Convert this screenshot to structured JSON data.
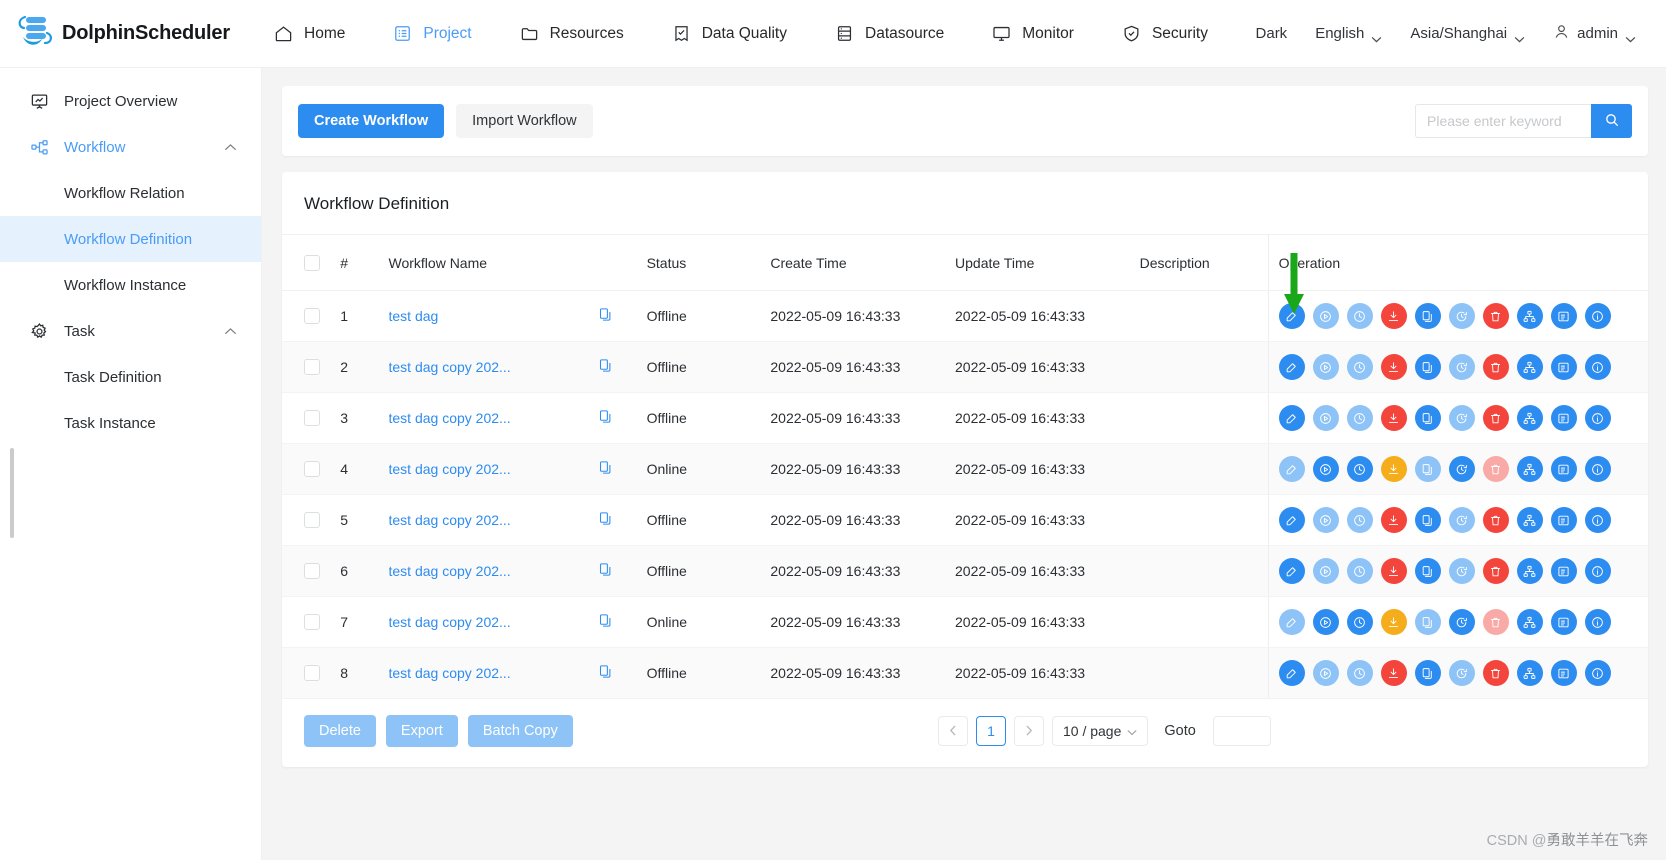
{
  "app": {
    "brand": "DolphinScheduler",
    "nav": [
      {
        "label": "Home",
        "icon": "home-icon",
        "active": false
      },
      {
        "label": "Project",
        "icon": "project-icon",
        "active": true
      },
      {
        "label": "Resources",
        "icon": "folder-icon",
        "active": false
      },
      {
        "label": "Data Quality",
        "icon": "data-quality-icon",
        "active": false
      },
      {
        "label": "Datasource",
        "icon": "database-icon",
        "active": false
      },
      {
        "label": "Monitor",
        "icon": "monitor-icon",
        "active": false
      },
      {
        "label": "Security",
        "icon": "shield-icon",
        "active": false
      }
    ],
    "nav_right": {
      "theme": "Dark",
      "language": "English",
      "timezone": "Asia/Shanghai",
      "user": "admin"
    },
    "accent_color": "#2d8cf0"
  },
  "sidebar": {
    "items": [
      {
        "label": "Project Overview",
        "icon": "overview-icon",
        "type": "item",
        "state": "normal"
      },
      {
        "label": "Workflow",
        "icon": "workflow-icon",
        "type": "group",
        "state": "accent",
        "expanded": true
      },
      {
        "label": "Workflow Relation",
        "type": "sub",
        "state": "normal"
      },
      {
        "label": "Workflow Definition",
        "type": "sub",
        "state": "selected"
      },
      {
        "label": "Workflow Instance",
        "type": "sub",
        "state": "normal"
      },
      {
        "label": "Task",
        "icon": "gear-icon",
        "type": "group",
        "state": "normal",
        "expanded": true
      },
      {
        "label": "Task Definition",
        "type": "sub",
        "state": "normal"
      },
      {
        "label": "Task Instance",
        "type": "sub",
        "state": "normal"
      }
    ]
  },
  "toolbar": {
    "create_label": "Create Workflow",
    "import_label": "Import Workflow",
    "search_placeholder": "Please enter keyword",
    "search_value": "",
    "search_icon": "search-icon"
  },
  "card": {
    "title": "Workflow Definition"
  },
  "table": {
    "columns": [
      "#",
      "Workflow Name",
      "Status",
      "Create Time",
      "Update Time",
      "Description",
      "Operation"
    ],
    "rows": [
      {
        "idx": "1",
        "name": "test dag",
        "status": "Offline",
        "create": "2022-05-09 16:43:33",
        "update": "2022-05-09 16:43:33",
        "desc": "",
        "checked": false
      },
      {
        "idx": "2",
        "name": "test dag copy 202...",
        "status": "Offline",
        "create": "2022-05-09 16:43:33",
        "update": "2022-05-09 16:43:33",
        "desc": "",
        "checked": false
      },
      {
        "idx": "3",
        "name": "test dag copy 202...",
        "status": "Offline",
        "create": "2022-05-09 16:43:33",
        "update": "2022-05-09 16:43:33",
        "desc": "",
        "checked": false
      },
      {
        "idx": "4",
        "name": "test dag copy 202...",
        "status": "Online",
        "create": "2022-05-09 16:43:33",
        "update": "2022-05-09 16:43:33",
        "desc": "",
        "checked": false
      },
      {
        "idx": "5",
        "name": "test dag copy 202...",
        "status": "Offline",
        "create": "2022-05-09 16:43:33",
        "update": "2022-05-09 16:43:33",
        "desc": "",
        "checked": false
      },
      {
        "idx": "6",
        "name": "test dag copy 202...",
        "status": "Offline",
        "create": "2022-05-09 16:43:33",
        "update": "2022-05-09 16:43:33",
        "desc": "",
        "checked": false
      },
      {
        "idx": "7",
        "name": "test dag copy 202...",
        "status": "Online",
        "create": "2022-05-09 16:43:33",
        "update": "2022-05-09 16:43:33",
        "desc": "",
        "checked": false
      },
      {
        "idx": "8",
        "name": "test dag copy 202...",
        "status": "Offline",
        "create": "2022-05-09 16:43:33",
        "update": "2022-05-09 16:43:33",
        "desc": "",
        "checked": false
      }
    ],
    "operations": [
      {
        "name": "edit-icon",
        "title": "Edit"
      },
      {
        "name": "start-icon",
        "title": "Start"
      },
      {
        "name": "timing-icon",
        "title": "Timing"
      },
      {
        "name": "download-icon",
        "title": "Download"
      },
      {
        "name": "copy-icon",
        "title": "Copy Workflow"
      },
      {
        "name": "cron-icon",
        "title": "Cron Manage"
      },
      {
        "name": "delete-icon",
        "title": "Delete"
      },
      {
        "name": "tree-icon",
        "title": "Tree View"
      },
      {
        "name": "export-icon",
        "title": "Export"
      },
      {
        "name": "version-icon",
        "title": "Version Info"
      }
    ],
    "op_colors": {
      "offline": [
        "#2d8cf0",
        "#8ec3f7",
        "#8ec3f7",
        "#f4453c",
        "#2d8cf0",
        "#8ec3f7",
        "#f4453c",
        "#2d8cf0",
        "#2d8cf0",
        "#2d8cf0"
      ],
      "online": [
        "#8ec3f7",
        "#2d8cf0",
        "#2d8cf0",
        "#f6ad1b",
        "#8ec3f7",
        "#2d8cf0",
        "#f9aaa6",
        "#2d8cf0",
        "#2d8cf0",
        "#2d8cf0"
      ]
    }
  },
  "footer": {
    "delete_label": "Delete",
    "export_label": "Export",
    "batch_copy_label": "Batch Copy",
    "prev_icon": "chevron-left-icon",
    "next_icon": "chevron-right-icon",
    "current_page": "1",
    "page_size": "10 / page",
    "goto_label": "Goto",
    "goto_value": ""
  },
  "annotation": {
    "arrow": "green-down-arrow",
    "arrow_color": "#1aa81a"
  },
  "watermark": {
    "prefix": "CSDN @",
    "name": "勇敢羊羊在飞奔"
  }
}
